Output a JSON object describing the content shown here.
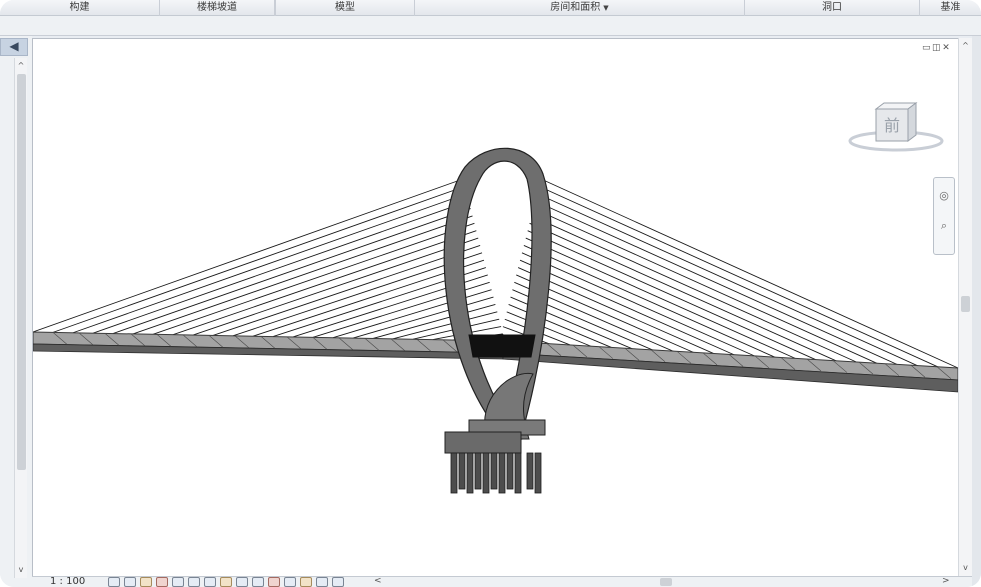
{
  "ribbon": {
    "tabs": [
      {
        "label": "构建"
      },
      {
        "label": "楼梯坡道"
      },
      {
        "label": "模型"
      },
      {
        "label": "房间和面积",
        "dropdown": true
      },
      {
        "label": "洞口"
      },
      {
        "label": "基准"
      }
    ]
  },
  "sidebar": {
    "collapse_glyph": "◀"
  },
  "view": {
    "window_controls": [
      "▭",
      "◫",
      "✕"
    ],
    "viewcube": {
      "icon": "viewcube-icon",
      "face_label": "前"
    },
    "navbar": {
      "icons": [
        "steering-wheel-icon",
        "zoom-region-icon"
      ]
    }
  },
  "status": {
    "scale": "1 : 100",
    "control_icons": [
      "detail-level-icon",
      "visual-style-icon",
      "sun-path-icon",
      "shadows-icon",
      "render-icon",
      "crop-view-icon",
      "show-crop-icon",
      "unlock-3d-icon",
      "temporary-hide-icon",
      "reveal-hidden-icon",
      "analysis-display-icon",
      "highlight-displacement-icon",
      "constraints-icon",
      "worksharing-icon",
      "design-options-icon"
    ],
    "scroll_left_glyph": "<",
    "scroll_right_glyph": ">"
  },
  "scrollbars": {
    "up_glyph": "^",
    "down_glyph": "v"
  },
  "colors": {
    "ribbon_bg": "#e3e7ec",
    "deck_top": "#8d8d8d",
    "deck_side": "#5a5a5a",
    "arch": "#6e6e6e",
    "cable": "#1a1a1a",
    "pier": "#5c5c5c"
  }
}
